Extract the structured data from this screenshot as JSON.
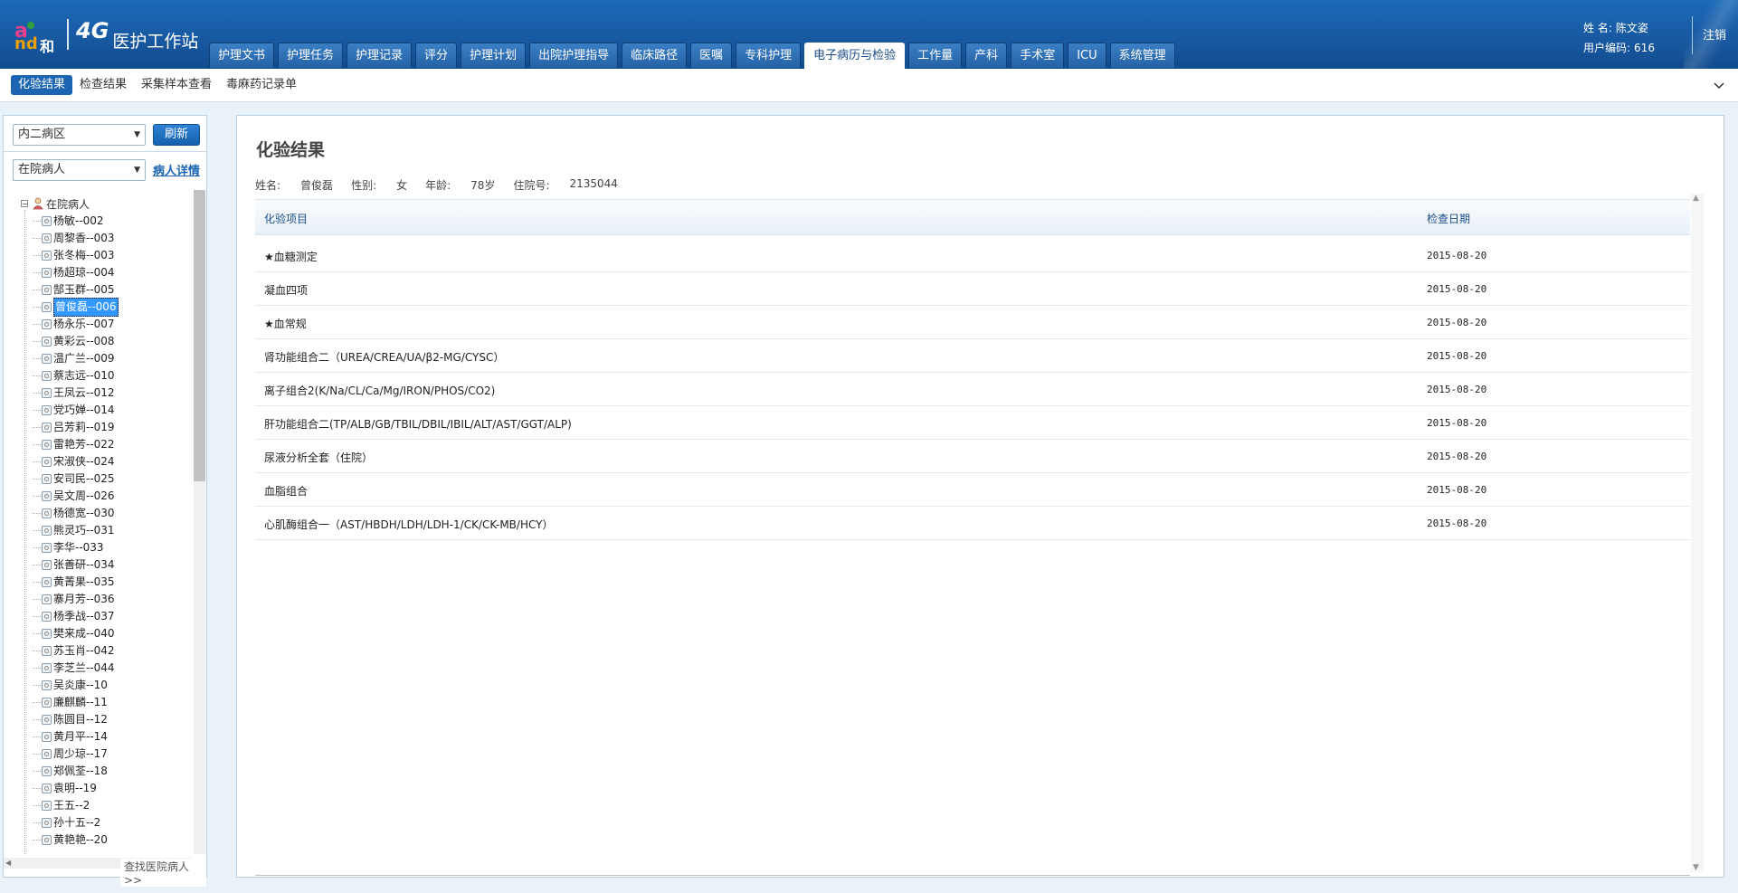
{
  "header": {
    "brand_a": "a",
    "brand_nd": "nd",
    "brand_he": "和",
    "network": "4G",
    "title": "医护工作站",
    "user_name_label": "姓 名:",
    "user_name": "陈文姿",
    "user_code_label": "用户编码:",
    "user_code": "616",
    "logout": "注销",
    "colors": {
      "header_bg": "#1758a0",
      "accent": "#1a64b2"
    }
  },
  "nav": {
    "tabs": [
      {
        "label": "护理文书"
      },
      {
        "label": "护理任务"
      },
      {
        "label": "护理记录"
      },
      {
        "label": "评分"
      },
      {
        "label": "护理计划"
      },
      {
        "label": "出院护理指导"
      },
      {
        "label": "临床路径"
      },
      {
        "label": "医嘱"
      },
      {
        "label": "专科护理"
      },
      {
        "label": "电子病历与检验"
      },
      {
        "label": "工作量"
      },
      {
        "label": "产科"
      },
      {
        "label": "手术室"
      },
      {
        "label": "ICU"
      },
      {
        "label": "系统管理"
      }
    ],
    "active_tab": "电子病历与检验"
  },
  "subnav": {
    "tabs": [
      {
        "label": "化验结果"
      },
      {
        "label": "检查结果"
      },
      {
        "label": "采集样本查看"
      },
      {
        "label": "毒麻药记录单"
      }
    ],
    "active_tab": "化验结果",
    "collapse_icon": "chevron-down-icon"
  },
  "left": {
    "ward_select": "内二病区",
    "refresh": "刷新",
    "patient_filter": "在院病人",
    "detail_link": "病人详情",
    "tree_root": "在院病人",
    "patients": [
      "杨敏--002",
      "周黎香--003",
      "张冬梅--003",
      "杨超琼--004",
      "郜玉群--005",
      "曾俊磊--006",
      "杨永乐--007",
      "黄彩云--008",
      "温广兰--009",
      "蔡志远--010",
      "王凤云--012",
      "党巧婵--014",
      "吕芳莉--019",
      "雷艳芳--022",
      "宋淑侠--024",
      "安司民--025",
      "吴文周--026",
      "杨德宽--030",
      "熊灵巧--031",
      "李华--033",
      "张善研--034",
      "黄菁果--035",
      "寨月芳--036",
      "杨季战--037",
      "樊来成--040",
      "苏玉肖--042",
      "李芝兰--044",
      "吴炎康--10",
      "廉麒麟--11",
      "陈圆目--12",
      "黄月平--14",
      "周少琼--17",
      "郑佩荃--18",
      "袁明--19",
      "王五--2",
      "孙十五--2",
      "黄艳艳--20"
    ],
    "selected_patient": "曾俊磊--006",
    "find_link": "查找医院病人>>"
  },
  "main": {
    "title": "化验结果",
    "patient": {
      "name_label": "姓名:",
      "name": "曾俊磊",
      "sex_label": "性别:",
      "sex": "女",
      "age_label": "年龄:",
      "age": "78岁",
      "admission_label": "住院号:",
      "admission_no": "2135044"
    },
    "columns": [
      "化验项目",
      "检查日期"
    ],
    "rows": [
      {
        "item": "★血糖测定",
        "date": "2015-08-20"
      },
      {
        "item": "凝血四项",
        "date": "2015-08-20"
      },
      {
        "item": "★血常规",
        "date": "2015-08-20"
      },
      {
        "item": "肾功能组合二（UREA/CREA/UA/β2-MG/CYSC）",
        "date": "2015-08-20"
      },
      {
        "item": "离子组合2(K/Na/CL/Ca/Mg/IRON/PHOS/CO2)",
        "date": "2015-08-20"
      },
      {
        "item": "肝功能组合二(TP/ALB/GB/TBIL/DBIL/IBIL/ALT/AST/GGT/ALP)",
        "date": "2015-08-20"
      },
      {
        "item": "尿液分析全套（住院）",
        "date": "2015-08-20"
      },
      {
        "item": "血脂组合",
        "date": "2015-08-20"
      },
      {
        "item": "心肌酶组合一（AST/HBDH/LDH/LDH-1/CK/CK-MB/HCY）",
        "date": "2015-08-20"
      }
    ]
  }
}
